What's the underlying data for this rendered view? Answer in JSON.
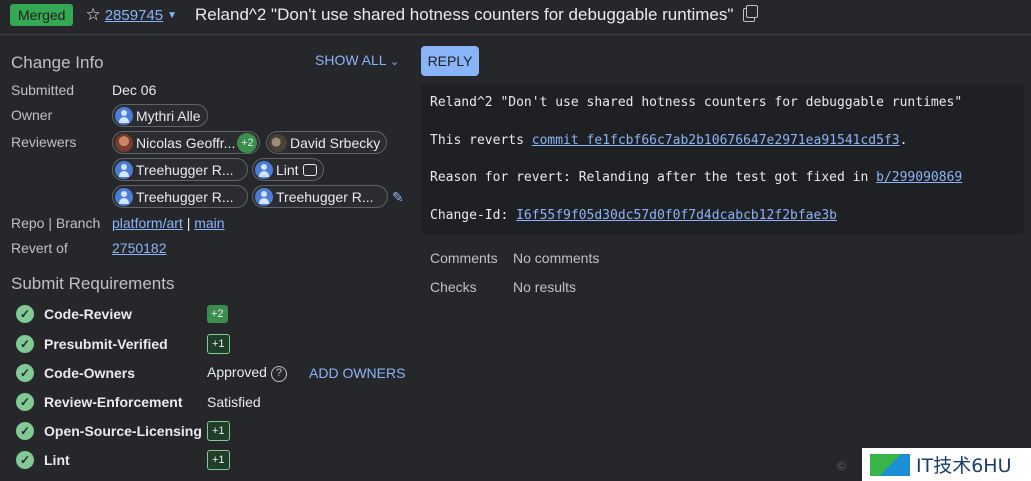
{
  "header": {
    "status": "Merged",
    "star_icon": "star-outline-icon",
    "change_number": "2859745",
    "subject": "Reland^2 \"Don't use shared hotness counters for debuggable runtimes\""
  },
  "change_info": {
    "title": "Change Info",
    "show_all": "SHOW ALL",
    "submitted_label": "Submitted",
    "submitted_value": "Dec 06",
    "owner_label": "Owner",
    "owner": "Mythri Alle",
    "reviewers_label": "Reviewers",
    "reviewers": [
      {
        "name": "Nicolas Geoffr...",
        "vote": "+2"
      },
      {
        "name": "David Srbecky"
      },
      {
        "name": "Treehugger R..."
      },
      {
        "name": "Lint"
      },
      {
        "name": "Treehugger R..."
      },
      {
        "name": "Treehugger R..."
      }
    ],
    "repo_label": "Repo | Branch",
    "repo": "platform/art",
    "branch_sep": "|",
    "branch": "main",
    "revert_label": "Revert of",
    "revert_of": "2750182"
  },
  "submit_requirements": {
    "title": "Submit Requirements",
    "items": [
      {
        "name": "Code-Review",
        "badge": "+2"
      },
      {
        "name": "Presubmit-Verified",
        "badge": "+1"
      },
      {
        "name": "Code-Owners",
        "status": "Approved",
        "action": "ADD OWNERS"
      },
      {
        "name": "Review-Enforcement",
        "status": "Satisfied"
      },
      {
        "name": "Open-Source-Licensing",
        "badge": "+1"
      },
      {
        "name": "Lint",
        "badge": "+1"
      }
    ]
  },
  "actions": {
    "reply": "REPLY"
  },
  "commit_message": {
    "line1": "Reland^2 \"Don't use shared hotness counters for debuggable runtimes\"",
    "revert_prefix": "This reverts ",
    "revert_link": "commit fe1fcbf66c7ab2b10676647e2971ea91541cd5f3",
    "revert_suffix": ".",
    "reason_prefix": "Reason for revert: Relanding after the test got fixed in ",
    "reason_link": "b/299090869",
    "changeid_prefix": "Change-Id: ",
    "changeid_link": "I6f55f9f05d30dc57d0f0f7d4dcabcb12f2bfae3b"
  },
  "side_info": {
    "comments_label": "Comments",
    "comments_value": "No comments",
    "checks_label": "Checks",
    "checks_value": "No results"
  },
  "watermark": {
    "text": "IT技术6HU",
    "small": "©"
  }
}
